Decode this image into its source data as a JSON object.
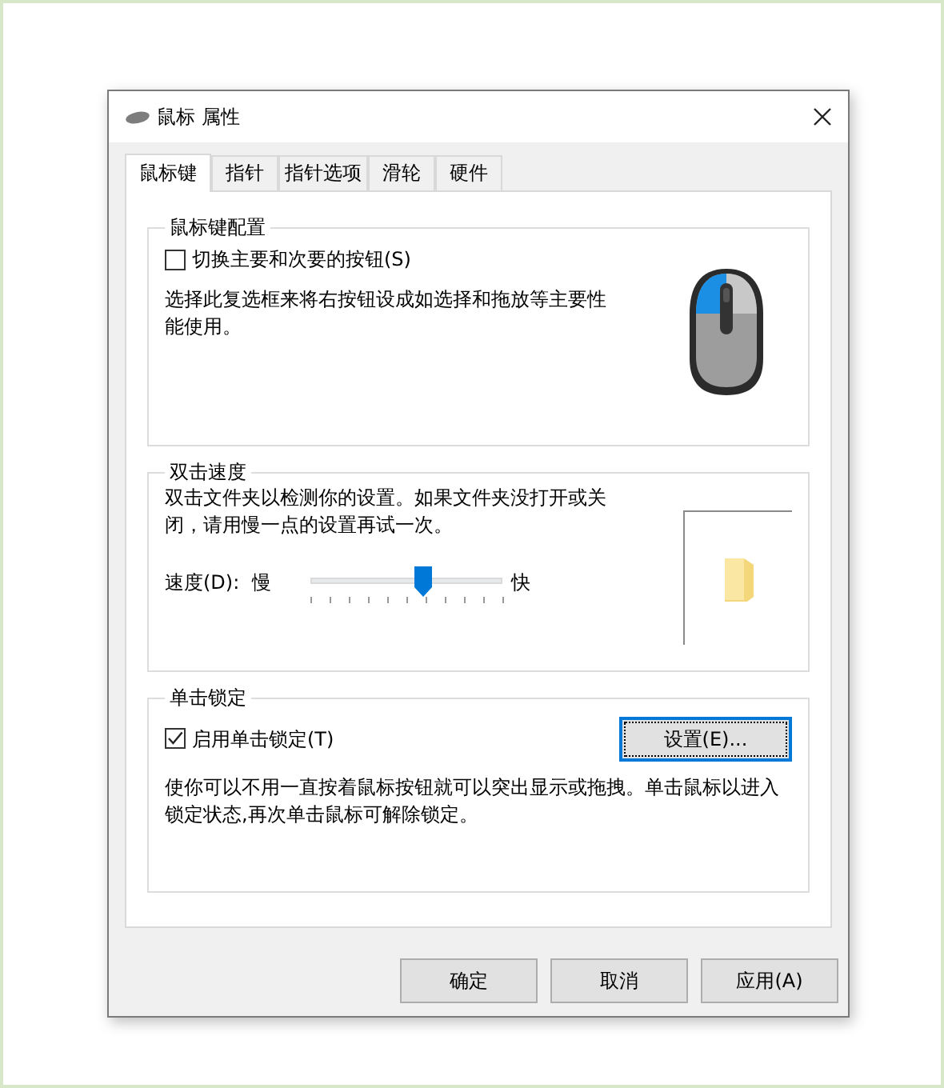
{
  "window": {
    "title": "鼠标 属性"
  },
  "tabs": [
    {
      "label": "鼠标键",
      "selected": true
    },
    {
      "label": "指针",
      "selected": false
    },
    {
      "label": "指针选项",
      "selected": false
    },
    {
      "label": "滑轮",
      "selected": false
    },
    {
      "label": "硬件",
      "selected": false
    }
  ],
  "button_config": {
    "title": "鼠标键配置",
    "checkbox": {
      "label": "切换主要和次要的按钮(S)",
      "checked": false
    },
    "description": "选择此复选框来将右按钮设成如选择和拖放等主要性能使用。"
  },
  "double_click": {
    "title": "双击速度",
    "description": "双击文件夹以检测你的设置。如果文件夹没打开或关闭，请用慢一点的设置再试一次。",
    "speed_label": "速度(D):",
    "slow_label": "慢",
    "fast_label": "快",
    "level": 0.59
  },
  "click_lock": {
    "title": "单击锁定",
    "checkbox": {
      "label": "启用单击锁定(T)",
      "checked": true
    },
    "settings_button": "设置(E)...",
    "description": "使你可以不用一直按着鼠标按钮就可以突出显示或拖拽。单击鼠标以进入锁定状态,再次单击鼠标可解除锁定。"
  },
  "buttons": [
    "确定",
    "取消",
    "应用(A)"
  ]
}
